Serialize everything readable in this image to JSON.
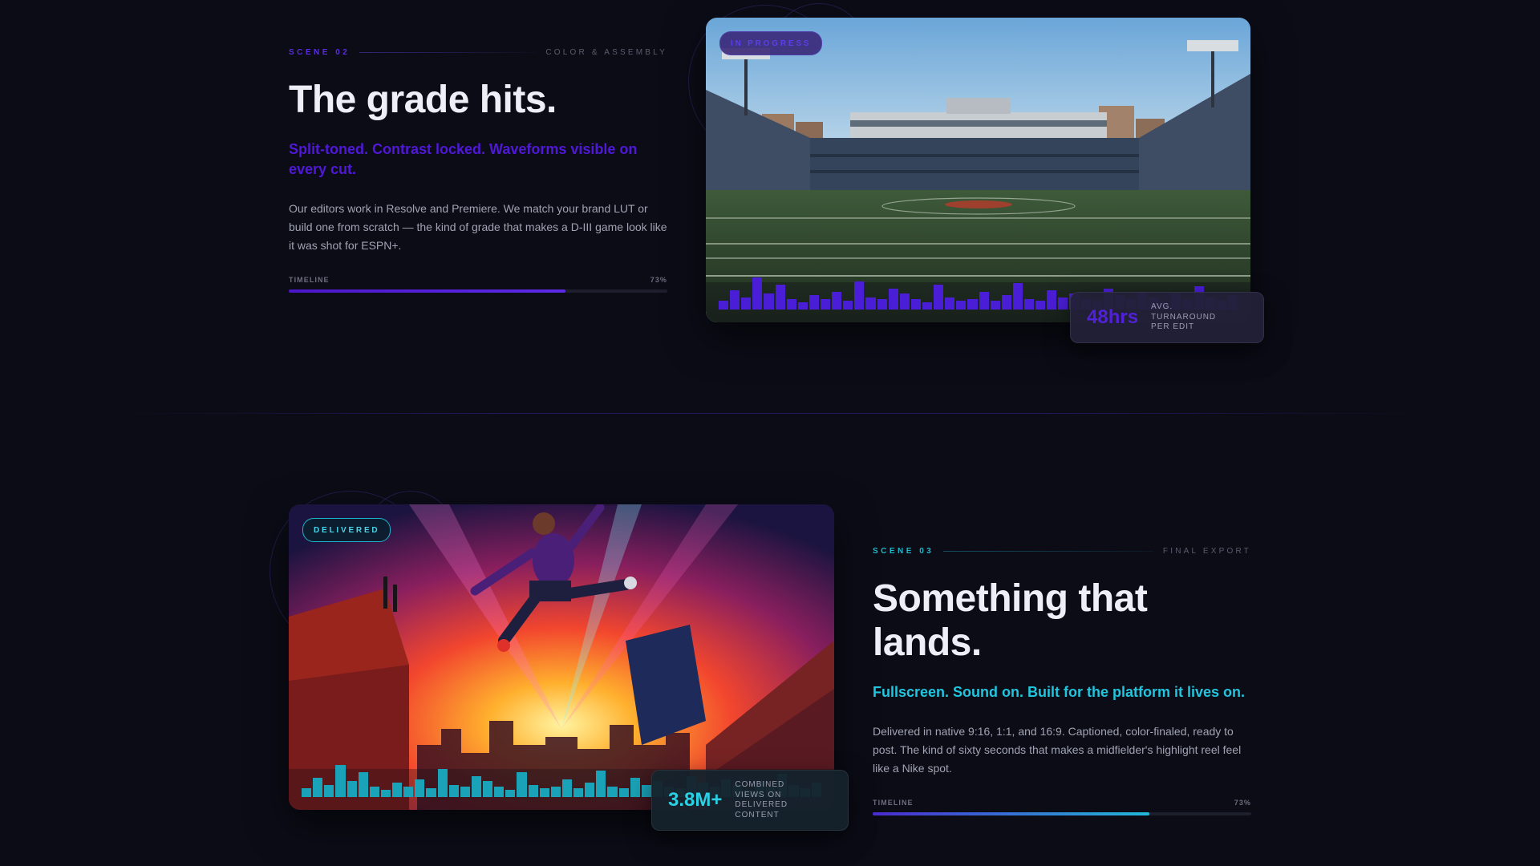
{
  "scene_02": {
    "label": "SCENE 02",
    "kicker": "COLOR & ASSEMBLY",
    "headline": "The grade hits.",
    "subhead": "Split-toned. Contrast locked. Waveforms visible on every cut.",
    "body": "Our editors work in Resolve and Premiere. We match your brand LUT or build one from scratch — the kind of grade that makes a D-III game look like it was shot for ESPN+.",
    "timeline_label": "TIMELINE",
    "timeline_value": "73%",
    "progress": 0.73,
    "badge": "IN PROGRESS",
    "stat_value": "48hrs",
    "stat_label": "AVG. TURNAROUND PER EDIT",
    "accent": "#5018d8"
  },
  "scene_03": {
    "label": "SCENE 03",
    "kicker": "FINAL EXPORT",
    "headline": "Something that lands.",
    "subhead": "Fullscreen. Sound on. Built for the platform it lives on.",
    "body": "Delivered in native 9:16, 1:1, and 16:9. Captioned, color-finaled, ready to post. The kind of sixty seconds that makes a midfielder's highlight reel feel like a Nike spot.",
    "timeline_label": "TIMELINE",
    "timeline_value": "73%",
    "progress": 0.73,
    "badge": "DELIVERED",
    "stat_value": "3.8M+",
    "stat_label": "COMBINED VIEWS ON DELIVERED CONTENT",
    "accent": "#21c6de"
  },
  "images": {
    "stadium": "stadium-photo",
    "jump": "rooftop-jump-photo"
  }
}
